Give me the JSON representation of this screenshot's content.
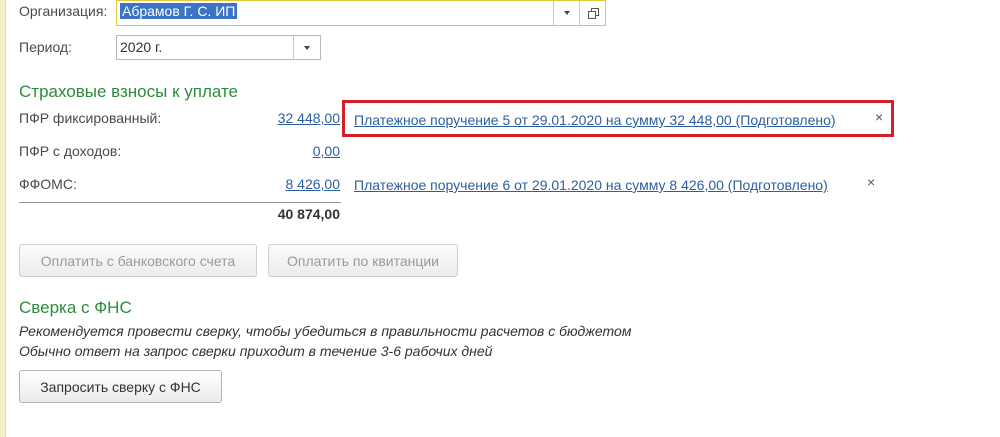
{
  "filters": {
    "organization_label": "Организация:",
    "organization_value": "Абрамов Г. С. ИП",
    "period_label": "Период:",
    "period_value": "2020 г."
  },
  "contributions": {
    "title": "Страховые взносы к уплате",
    "rows": [
      {
        "label": "ПФР фиксированный:",
        "amount": "32 448,00",
        "payment_link": "Платежное поручение 5 от 29.01.2020 на сумму 32 448,00 (Подготовлено)",
        "remove": "×"
      },
      {
        "label": "ПФР с доходов:",
        "amount": "0,00"
      },
      {
        "label": "ФФОМС:",
        "amount": "8 426,00",
        "payment_link": "Платежное поручение 6 от 29.01.2020 на сумму 8 426,00 (Подготовлено)",
        "remove": "×"
      }
    ],
    "total": "40 874,00",
    "pay_bank_button": "Оплатить с банковского счета",
    "pay_receipt_button": "Оплатить по квитанции"
  },
  "reconciliation": {
    "title": "Сверка с ФНС",
    "note_line1": "Рекомендуется провести сверку, чтобы убедиться в правильности расчетов с бюджетом",
    "note_line2": "Обычно ответ на запрос сверки приходит в течение 3-6 рабочих дней",
    "request_button": "Запросить сверку с ФНС"
  },
  "colors": {
    "section_title": "#2b8c3b",
    "link": "#2d5fa0",
    "highlight_frame": "#d2202a",
    "selection": "#3c73c6"
  }
}
